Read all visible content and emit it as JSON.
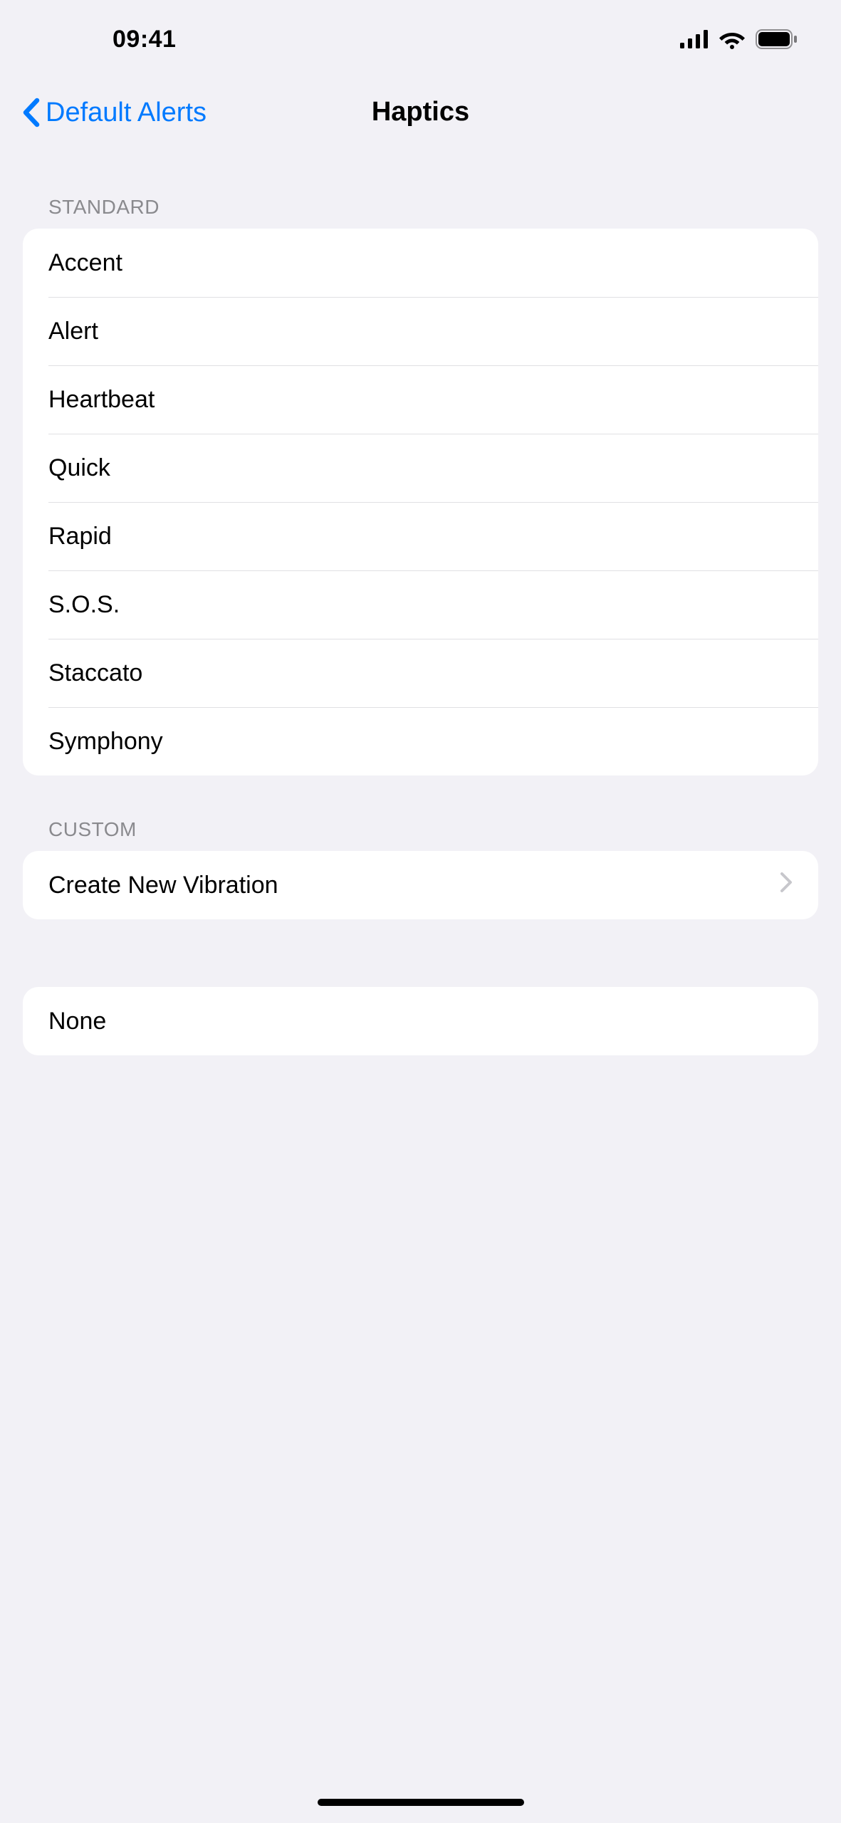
{
  "status": {
    "time": "09:41"
  },
  "nav": {
    "back_label": "Default Alerts",
    "title": "Haptics"
  },
  "sections": {
    "standard": {
      "header": "STANDARD",
      "items": [
        "Accent",
        "Alert",
        "Heartbeat",
        "Quick",
        "Rapid",
        "S.O.S.",
        "Staccato",
        "Symphony"
      ]
    },
    "custom": {
      "header": "CUSTOM",
      "create_label": "Create New Vibration"
    },
    "none": {
      "label": "None"
    }
  }
}
